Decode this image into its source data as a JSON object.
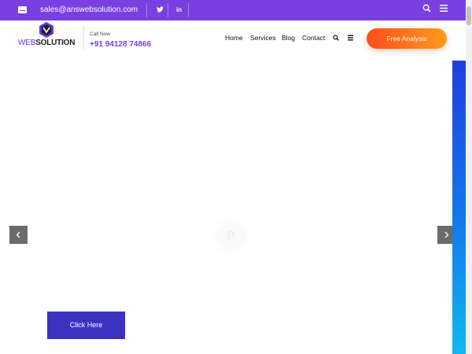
{
  "topbar": {
    "email": "sales@answebsolution.com",
    "twitter_label": "t",
    "linkedin_label": "in"
  },
  "header": {
    "logo_web": "WEB",
    "logo_solution": "SOLUTION",
    "call_now": "Call Now",
    "phone": "+91 94128 74866",
    "nav": [
      "Home",
      "Services",
      "Blog",
      "Contact"
    ],
    "cta_label": "Free Analysis"
  },
  "hero": {
    "click_label": "Click Here",
    "loader_letter": "p"
  },
  "colors": {
    "topbar": "#7a3fe0",
    "cta_start": "#ff4d1d",
    "cta_end": "#ff9a1d",
    "click_button": "#3b33c0"
  }
}
